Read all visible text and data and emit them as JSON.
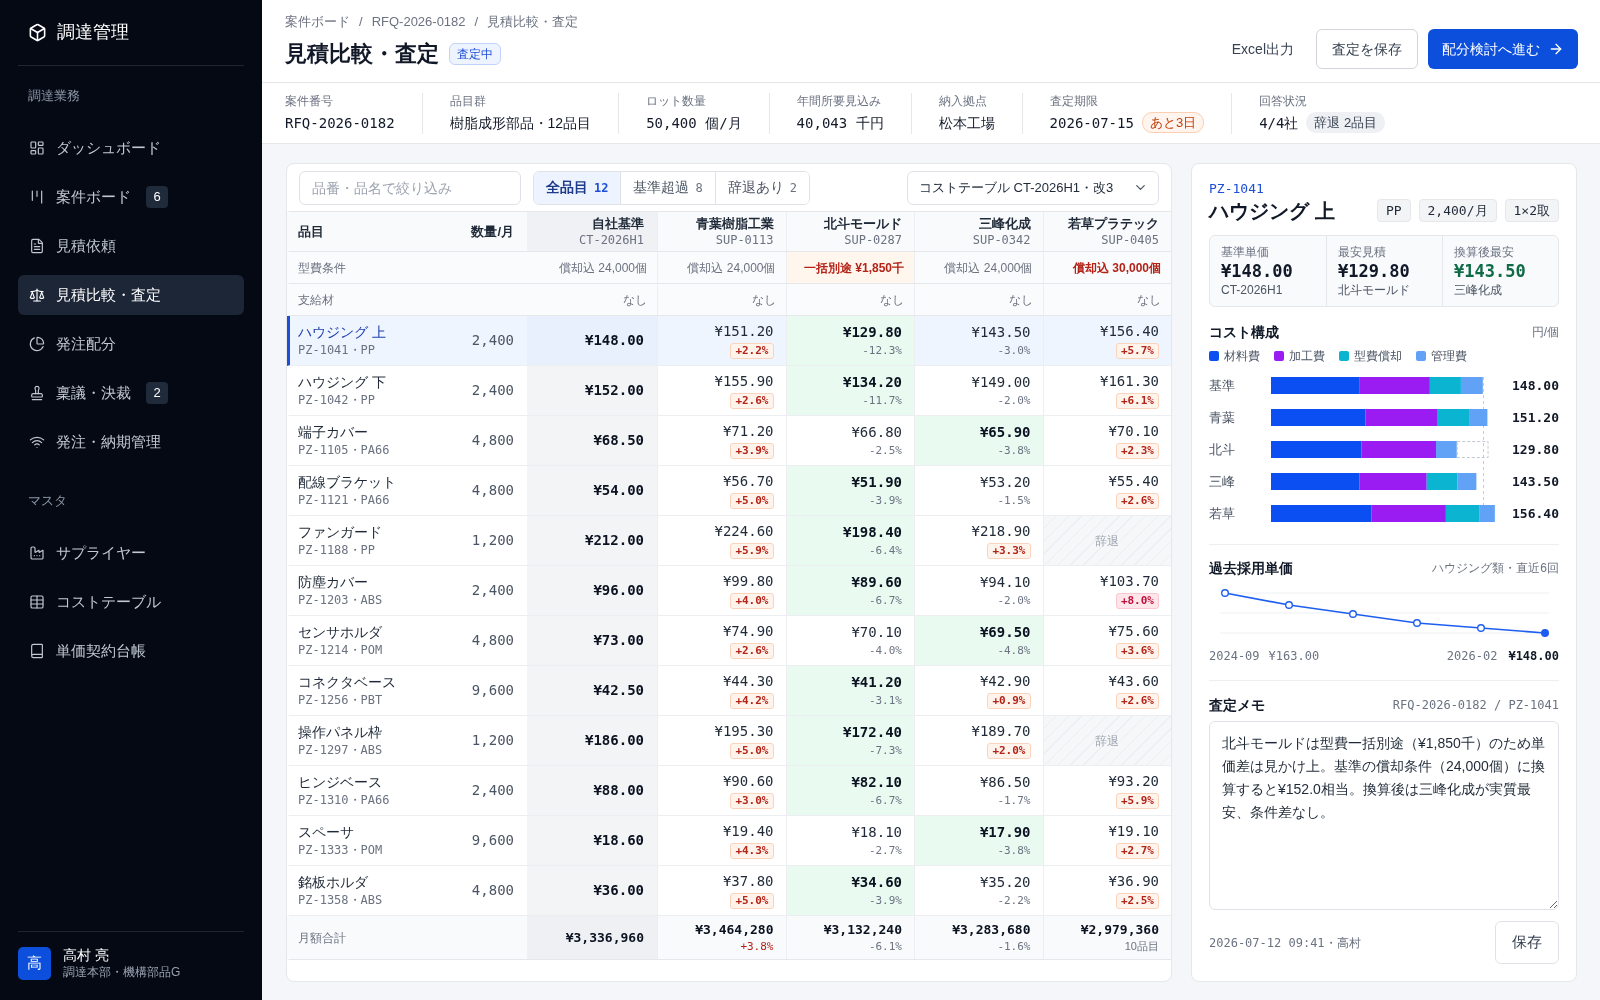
{
  "sidebar": {
    "brand": "調達管理",
    "sections": [
      {
        "title": "調達業務",
        "items": [
          {
            "label": "ダッシュボード",
            "selected": false
          },
          {
            "label": "案件ボード",
            "badge": "6",
            "selected": false
          },
          {
            "label": "見積依頼",
            "selected": false
          },
          {
            "label": "見積比較・査定",
            "selected": true
          },
          {
            "label": "発注配分",
            "selected": false
          },
          {
            "label": "稟議・決裁",
            "badge": "2",
            "selected": false
          },
          {
            "label": "発注・納期管理",
            "selected": false
          }
        ]
      },
      {
        "title": "マスタ",
        "items": [
          {
            "label": "サプライヤー",
            "selected": false
          },
          {
            "label": "コストテーブル",
            "selected": false
          },
          {
            "label": "単価契約台帳",
            "selected": false
          }
        ]
      }
    ],
    "user": {
      "avatar": "高",
      "name": "高村 亮",
      "department": "調達本部・機構部品G"
    }
  },
  "header": {
    "breadcrumb": {
      "items": [
        "案件ボード",
        "RFQ-2026-0182",
        "見積比較・査定"
      ],
      "separator": "/"
    },
    "title": "見積比較・査定",
    "status_badge": "査定中",
    "actions": [
      {
        "label": "Excel出力",
        "kind": "text"
      },
      {
        "label": "査定を保存",
        "kind": "outline"
      },
      {
        "label": "配分検討へ進む",
        "kind": "primary"
      }
    ]
  },
  "summary": [
    {
      "label": "案件番号",
      "value": "RFQ-2026-0182",
      "kind": "numeric"
    },
    {
      "label": "品目群",
      "value": "樹脂成形部品・12品目",
      "kind": "text"
    },
    {
      "label": "ロット数量",
      "value": "50,400 個/月",
      "kind": "numeric"
    },
    {
      "label": "年間所要見込み",
      "value": "40,043 千円",
      "kind": "numeric"
    },
    {
      "label": "納入拠点",
      "value": "松本工場",
      "kind": "text"
    },
    {
      "label": "査定期限",
      "value": "2026-07-15",
      "kind": "numeric",
      "tag": "あと3日",
      "urgent": true
    },
    {
      "label": "回答状況",
      "value": "4/4社",
      "kind": "numeric",
      "tag": "辞退 2品目",
      "urgent": false
    }
  ],
  "table": {
    "search": {
      "placeholder": "品番・品名で絞り込み"
    },
    "tabs": [
      {
        "label": "全品目",
        "count": "12",
        "selected": true
      },
      {
        "label": "基準超過",
        "count": "8",
        "selected": false
      },
      {
        "label": "辞退あり",
        "count": "2",
        "selected": false
      }
    ],
    "cost_table_select": {
      "value": "コストテーブル CT-2026H1・改3"
    },
    "columns": {
      "item": "品目",
      "quantity": "数量/月",
      "baseline": {
        "name": "自社基準",
        "code": "CT-2026H1"
      },
      "suppliers": [
        {
          "name": "青葉樹脂工業",
          "code": "SUP-0113"
        },
        {
          "name": "北斗モールド",
          "code": "SUP-0287"
        },
        {
          "name": "三峰化成",
          "code": "SUP-0342"
        },
        {
          "name": "若草プラテック",
          "code": "SUP-0405"
        }
      ]
    },
    "conditions": [
      {
        "label": "型費条件",
        "cells": [
          {
            "text": "償却込 24,000個",
            "flagged": false,
            "highlighted": false
          },
          {
            "text": "償却込 24,000個",
            "flagged": false,
            "highlighted": false
          },
          {
            "text": "一括別途 ¥1,850千",
            "flagged": true,
            "highlighted": true
          },
          {
            "text": "償却込 24,000個",
            "flagged": false,
            "highlighted": false
          },
          {
            "text": "償却込 30,000個",
            "flagged": true,
            "highlighted": false
          }
        ]
      },
      {
        "label": "支給材",
        "cells": [
          {
            "text": "なし",
            "flagged": false,
            "highlighted": false
          },
          {
            "text": "なし",
            "flagged": false,
            "highlighted": false
          },
          {
            "text": "なし",
            "flagged": false,
            "highlighted": false
          },
          {
            "text": "なし",
            "flagged": false,
            "highlighted": false
          },
          {
            "text": "なし",
            "flagged": false,
            "highlighted": false
          }
        ]
      }
    ],
    "rows": [
      {
        "name": "ハウジング 上",
        "code": "PZ-1041・PP",
        "quantity": "2,400",
        "baseline": "¥148.00",
        "selected": true,
        "quotes": [
          {
            "kind": "quote",
            "price": "¥151.20",
            "delta": "+2.2%",
            "over": true,
            "alert": false,
            "lowest": false
          },
          {
            "kind": "quote",
            "price": "¥129.80",
            "delta": "-12.3%",
            "over": false,
            "alert": false,
            "lowest": true
          },
          {
            "kind": "quote",
            "price": "¥143.50",
            "delta": "-3.0%",
            "over": false,
            "alert": false,
            "lowest": false
          },
          {
            "kind": "quote",
            "price": "¥156.40",
            "delta": "+5.7%",
            "over": true,
            "alert": false,
            "lowest": false
          }
        ]
      },
      {
        "name": "ハウジング 下",
        "code": "PZ-1042・PP",
        "quantity": "2,400",
        "baseline": "¥152.00",
        "selected": false,
        "quotes": [
          {
            "kind": "quote",
            "price": "¥155.90",
            "delta": "+2.6%",
            "over": true,
            "alert": false,
            "lowest": false
          },
          {
            "kind": "quote",
            "price": "¥134.20",
            "delta": "-11.7%",
            "over": false,
            "alert": false,
            "lowest": true
          },
          {
            "kind": "quote",
            "price": "¥149.00",
            "delta": "-2.0%",
            "over": false,
            "alert": false,
            "lowest": false
          },
          {
            "kind": "quote",
            "price": "¥161.30",
            "delta": "+6.1%",
            "over": true,
            "alert": false,
            "lowest": false
          }
        ]
      },
      {
        "name": "端子カバー",
        "code": "PZ-1105・PA66",
        "quantity": "4,800",
        "baseline": "¥68.50",
        "selected": false,
        "quotes": [
          {
            "kind": "quote",
            "price": "¥71.20",
            "delta": "+3.9%",
            "over": true,
            "alert": false,
            "lowest": false
          },
          {
            "kind": "quote",
            "price": "¥66.80",
            "delta": "-2.5%",
            "over": false,
            "alert": false,
            "lowest": false
          },
          {
            "kind": "quote",
            "price": "¥65.90",
            "delta": "-3.8%",
            "over": false,
            "alert": false,
            "lowest": true
          },
          {
            "kind": "quote",
            "price": "¥70.10",
            "delta": "+2.3%",
            "over": true,
            "alert": false,
            "lowest": false
          }
        ]
      },
      {
        "name": "配線ブラケット",
        "code": "PZ-1121・PA66",
        "quantity": "4,800",
        "baseline": "¥54.00",
        "selected": false,
        "quotes": [
          {
            "kind": "quote",
            "price": "¥56.70",
            "delta": "+5.0%",
            "over": true,
            "alert": false,
            "lowest": false
          },
          {
            "kind": "quote",
            "price": "¥51.90",
            "delta": "-3.9%",
            "over": false,
            "alert": false,
            "lowest": true
          },
          {
            "kind": "quote",
            "price": "¥53.20",
            "delta": "-1.5%",
            "over": false,
            "alert": false,
            "lowest": false
          },
          {
            "kind": "quote",
            "price": "¥55.40",
            "delta": "+2.6%",
            "over": true,
            "alert": false,
            "lowest": false
          }
        ]
      },
      {
        "name": "ファンガード",
        "code": "PZ-1188・PP",
        "quantity": "1,200",
        "baseline": "¥212.00",
        "selected": false,
        "quotes": [
          {
            "kind": "quote",
            "price": "¥224.60",
            "delta": "+5.9%",
            "over": true,
            "alert": false,
            "lowest": false
          },
          {
            "kind": "quote",
            "price": "¥198.40",
            "delta": "-6.4%",
            "over": false,
            "alert": false,
            "lowest": true
          },
          {
            "kind": "quote",
            "price": "¥218.90",
            "delta": "+3.3%",
            "over": true,
            "alert": false,
            "lowest": false
          },
          {
            "kind": "declined",
            "label": "辞退"
          }
        ]
      },
      {
        "name": "防塵カバー",
        "code": "PZ-1203・ABS",
        "quantity": "2,400",
        "baseline": "¥96.00",
        "selected": false,
        "quotes": [
          {
            "kind": "quote",
            "price": "¥99.80",
            "delta": "+4.0%",
            "over": true,
            "alert": false,
            "lowest": false
          },
          {
            "kind": "quote",
            "price": "¥89.60",
            "delta": "-6.7%",
            "over": false,
            "alert": false,
            "lowest": true
          },
          {
            "kind": "quote",
            "price": "¥94.10",
            "delta": "-2.0%",
            "over": false,
            "alert": false,
            "lowest": false
          },
          {
            "kind": "quote",
            "price": "¥103.70",
            "delta": "+8.0%",
            "over": true,
            "alert": true,
            "lowest": false
          }
        ]
      },
      {
        "name": "センサホルダ",
        "code": "PZ-1214・POM",
        "quantity": "4,800",
        "baseline": "¥73.00",
        "selected": false,
        "quotes": [
          {
            "kind": "quote",
            "price": "¥74.90",
            "delta": "+2.6%",
            "over": true,
            "alert": false,
            "lowest": false
          },
          {
            "kind": "quote",
            "price": "¥70.10",
            "delta": "-4.0%",
            "over": false,
            "alert": false,
            "lowest": false
          },
          {
            "kind": "quote",
            "price": "¥69.50",
            "delta": "-4.8%",
            "over": false,
            "alert": false,
            "lowest": true
          },
          {
            "kind": "quote",
            "price": "¥75.60",
            "delta": "+3.6%",
            "over": true,
            "alert": false,
            "lowest": false
          }
        ]
      },
      {
        "name": "コネクタベース",
        "code": "PZ-1256・PBT",
        "quantity": "9,600",
        "baseline": "¥42.50",
        "selected": false,
        "quotes": [
          {
            "kind": "quote",
            "price": "¥44.30",
            "delta": "+4.2%",
            "over": true,
            "alert": false,
            "lowest": false
          },
          {
            "kind": "quote",
            "price": "¥41.20",
            "delta": "-3.1%",
            "over": false,
            "alert": false,
            "lowest": true
          },
          {
            "kind": "quote",
            "price": "¥42.90",
            "delta": "+0.9%",
            "over": true,
            "alert": false,
            "lowest": false
          },
          {
            "kind": "quote",
            "price": "¥43.60",
            "delta": "+2.6%",
            "over": true,
            "alert": false,
            "lowest": false
          }
        ]
      },
      {
        "name": "操作パネル枠",
        "code": "PZ-1297・ABS",
        "quantity": "1,200",
        "baseline": "¥186.00",
        "selected": false,
        "quotes": [
          {
            "kind": "quote",
            "price": "¥195.30",
            "delta": "+5.0%",
            "over": true,
            "alert": false,
            "lowest": false
          },
          {
            "kind": "quote",
            "price": "¥172.40",
            "delta": "-7.3%",
            "over": false,
            "alert": false,
            "lowest": true
          },
          {
            "kind": "quote",
            "price": "¥189.70",
            "delta": "+2.0%",
            "over": true,
            "alert": false,
            "lowest": false
          },
          {
            "kind": "declined",
            "label": "辞退"
          }
        ]
      },
      {
        "name": "ヒンジベース",
        "code": "PZ-1310・PA66",
        "quantity": "2,400",
        "baseline": "¥88.00",
        "selected": false,
        "quotes": [
          {
            "kind": "quote",
            "price": "¥90.60",
            "delta": "+3.0%",
            "over": true,
            "alert": false,
            "lowest": false
          },
          {
            "kind": "quote",
            "price": "¥82.10",
            "delta": "-6.7%",
            "over": false,
            "alert": false,
            "lowest": true
          },
          {
            "kind": "quote",
            "price": "¥86.50",
            "delta": "-1.7%",
            "over": false,
            "alert": false,
            "lowest": false
          },
          {
            "kind": "quote",
            "price": "¥93.20",
            "delta": "+5.9%",
            "over": true,
            "alert": false,
            "lowest": false
          }
        ]
      },
      {
        "name": "スペーサ",
        "code": "PZ-1333・POM",
        "quantity": "9,600",
        "baseline": "¥18.60",
        "selected": false,
        "quotes": [
          {
            "kind": "quote",
            "price": "¥19.40",
            "delta": "+4.3%",
            "over": true,
            "alert": false,
            "lowest": false
          },
          {
            "kind": "quote",
            "price": "¥18.10",
            "delta": "-2.7%",
            "over": false,
            "alert": false,
            "lowest": false
          },
          {
            "kind": "quote",
            "price": "¥17.90",
            "delta": "-3.8%",
            "over": false,
            "alert": false,
            "lowest": true
          },
          {
            "kind": "quote",
            "price": "¥19.10",
            "delta": "+2.7%",
            "over": true,
            "alert": false,
            "lowest": false
          }
        ]
      },
      {
        "name": "銘板ホルダ",
        "code": "PZ-1358・ABS",
        "quantity": "4,800",
        "baseline": "¥36.00",
        "selected": false,
        "quotes": [
          {
            "kind": "quote",
            "price": "¥37.80",
            "delta": "+5.0%",
            "over": true,
            "alert": false,
            "lowest": false
          },
          {
            "kind": "quote",
            "price": "¥34.60",
            "delta": "-3.9%",
            "over": false,
            "alert": false,
            "lowest": true
          },
          {
            "kind": "quote",
            "price": "¥35.20",
            "delta": "-2.2%",
            "over": false,
            "alert": false,
            "lowest": false
          },
          {
            "kind": "quote",
            "price": "¥36.90",
            "delta": "+2.5%",
            "over": true,
            "alert": false,
            "lowest": false
          }
        ]
      }
    ],
    "total": {
      "label": "月額合計",
      "baseline": "¥3,336,960",
      "suppliers": [
        {
          "value": "¥3,464,280",
          "note": "+3.8%",
          "kind": "delta",
          "over": true
        },
        {
          "value": "¥3,132,240",
          "note": "-6.1%",
          "kind": "delta",
          "over": false
        },
        {
          "value": "¥3,283,680",
          "note": "-1.6%",
          "kind": "delta",
          "over": false
        },
        {
          "value": "¥2,979,360",
          "note": "10品目",
          "kind": "count",
          "over": false
        }
      ]
    }
  },
  "detail": {
    "code": "PZ-1041",
    "name": "ハウジング 上",
    "chips": [
      "PP",
      "2,400/月",
      "1×2取"
    ],
    "stats": [
      {
        "label": "基準単価",
        "value": "¥148.00",
        "sub": "CT-2026H1",
        "best": false
      },
      {
        "label": "最安見積",
        "value": "¥129.80",
        "sub": "北斗モールド",
        "best": false
      },
      {
        "label": "換算後最安",
        "value": "¥143.50",
        "sub": "三峰化成",
        "best": true
      }
    ],
    "cost_breakdown": {
      "title": "コスト構成",
      "unit": "円/個",
      "legend": [
        {
          "name": "材料費",
          "color": "#0b4ff2"
        },
        {
          "name": "加工費",
          "color": "#9b1cf2"
        },
        {
          "name": "型費償却",
          "color": "#0bb5d2"
        },
        {
          "name": "管理費",
          "color": "#62a2f6"
        }
      ],
      "rows": [
        {
          "label": "基準",
          "value": "148.00"
        },
        {
          "label": "青葉",
          "value": "151.20"
        },
        {
          "label": "北斗",
          "value": "129.80"
        },
        {
          "label": "三峰",
          "value": "143.50"
        },
        {
          "label": "若草",
          "value": "156.40"
        }
      ]
    },
    "history": {
      "title": "過去採用単価",
      "subtitle": "ハウジング類・直近6回",
      "start_label": "2024-09",
      "start_value": "¥163.00",
      "end_label": "2026-02",
      "end_value": "¥148.00"
    },
    "memo": {
      "title": "査定メモ",
      "reference": "RFQ-2026-0182 / PZ-1041",
      "value": "北斗モールドは型費一括別途（¥1,850千）のため単価差は見かけ上。基準の償却条件（24,000個）に換算すると¥152.0相当。換算後は三峰化成が実質最安、条件差なし。",
      "footer": "2026-07-12 09:41・高村",
      "button": "保存"
    }
  }
}
